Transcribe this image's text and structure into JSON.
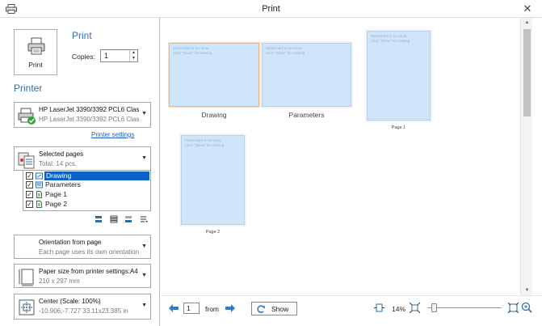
{
  "window": {
    "title": "Print"
  },
  "print_section": {
    "button_label": "Print",
    "heading": "Print",
    "copies_label": "Copies:",
    "copies_value": "1"
  },
  "printer_section": {
    "heading": "Printer",
    "printer_name": "HP LaserJet 3390/3392 PCL6 Clas...",
    "printer_sub": "HP LaserJet 3390/3392 PCL6 Clas...",
    "settings_link": "Printer settings"
  },
  "pages_section": {
    "title": "Selected pages",
    "subtitle": "Total: 14 pcs.",
    "items": [
      {
        "label": "Drawing",
        "checked": true,
        "selected": true
      },
      {
        "label": "Parameters",
        "checked": true,
        "selected": false
      },
      {
        "label": "Page 1",
        "checked": true,
        "selected": false
      },
      {
        "label": "Page 2",
        "checked": true,
        "selected": false
      }
    ]
  },
  "orientation": {
    "title": "Orientation from page",
    "subtitle": "Each page uses its own orientation"
  },
  "paper": {
    "title": "Paper size from printer settings:A4",
    "subtitle": "210 x 297 mm"
  },
  "center": {
    "title": "Center (Scale: 100%)",
    "subtitle": "-10.906;-7.727  33.11x23.385 in"
  },
  "preview": {
    "watermark_line1": "Watermark is too slow.",
    "watermark_line2": "Click \"Show\" for viewing",
    "thumbnails": [
      {
        "label": "Drawing",
        "selected": true
      },
      {
        "label": "Parameters",
        "selected": false
      },
      {
        "label": "Page 1",
        "selected": false
      },
      {
        "label": "Page 2",
        "selected": false
      }
    ]
  },
  "bottom_bar": {
    "page_value": "1",
    "from_label": "from",
    "show_label": "Show",
    "zoom_label": "14%",
    "zoom_fraction": 0.05
  },
  "colors": {
    "accent_heading": "#2e6fa8",
    "link": "#1f5fbf",
    "selection": "#0a64c8",
    "page_fill": "#cfe6fa",
    "selected_page_border": "#f3b37a"
  }
}
